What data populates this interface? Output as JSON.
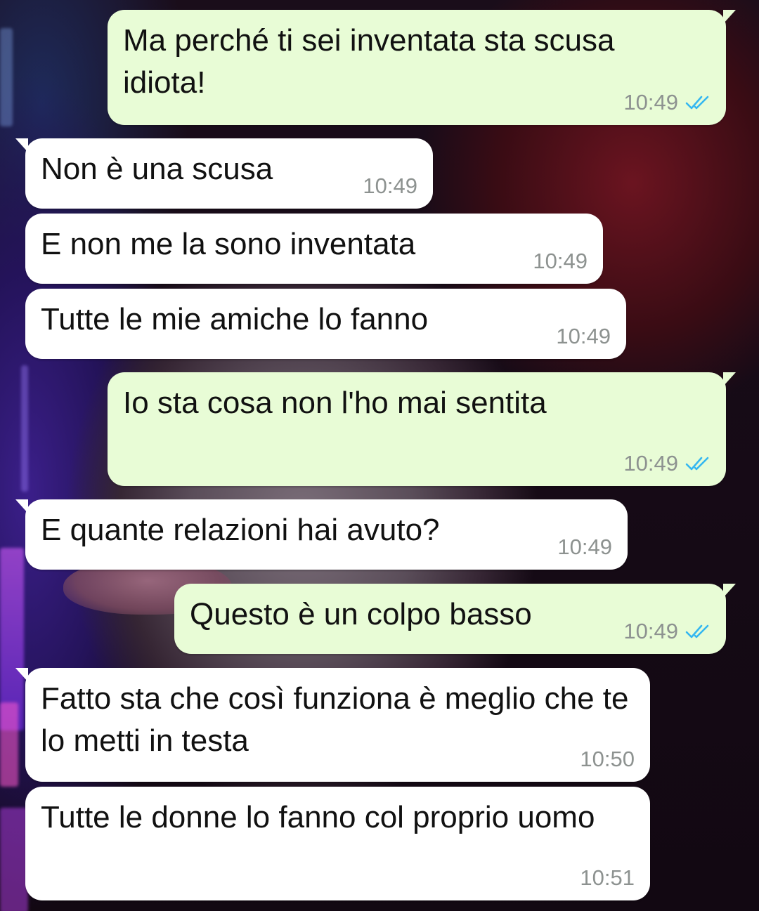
{
  "conversation": {
    "messages": [
      {
        "direction": "out",
        "text": "Ma perché ti sei inventata sta scusa idiota!",
        "time": "10:49",
        "status_icon": "double-check-icon",
        "status_color": "#34b7f1"
      },
      {
        "direction": "in",
        "text": "Non è una scusa",
        "time": "10:49"
      },
      {
        "direction": "in",
        "text": "E non me la sono inventata",
        "time": "10:49"
      },
      {
        "direction": "in",
        "text": "Tutte le mie amiche lo fanno",
        "time": "10:49"
      },
      {
        "direction": "out",
        "text": "Io sta cosa non l'ho mai sentita",
        "time": "10:49",
        "status_icon": "double-check-icon",
        "status_color": "#34b7f1"
      },
      {
        "direction": "in",
        "text": "E quante relazioni hai avuto?",
        "time": "10:49"
      },
      {
        "direction": "out",
        "text": "Questo è un colpo basso",
        "time": "10:49",
        "status_icon": "double-check-icon",
        "status_color": "#34b7f1"
      },
      {
        "direction": "in",
        "text": "Fatto sta che così funziona è meglio che te lo metti in testa",
        "time": "10:50"
      },
      {
        "direction": "in",
        "text": "Tutte le donne lo fanno col proprio uomo",
        "time": "10:51"
      }
    ]
  },
  "colors": {
    "incoming_bubble": "#ffffff",
    "outgoing_bubble": "#e8fcd6",
    "timestamp": "#8d9290",
    "read_receipt": "#34b7f1"
  }
}
